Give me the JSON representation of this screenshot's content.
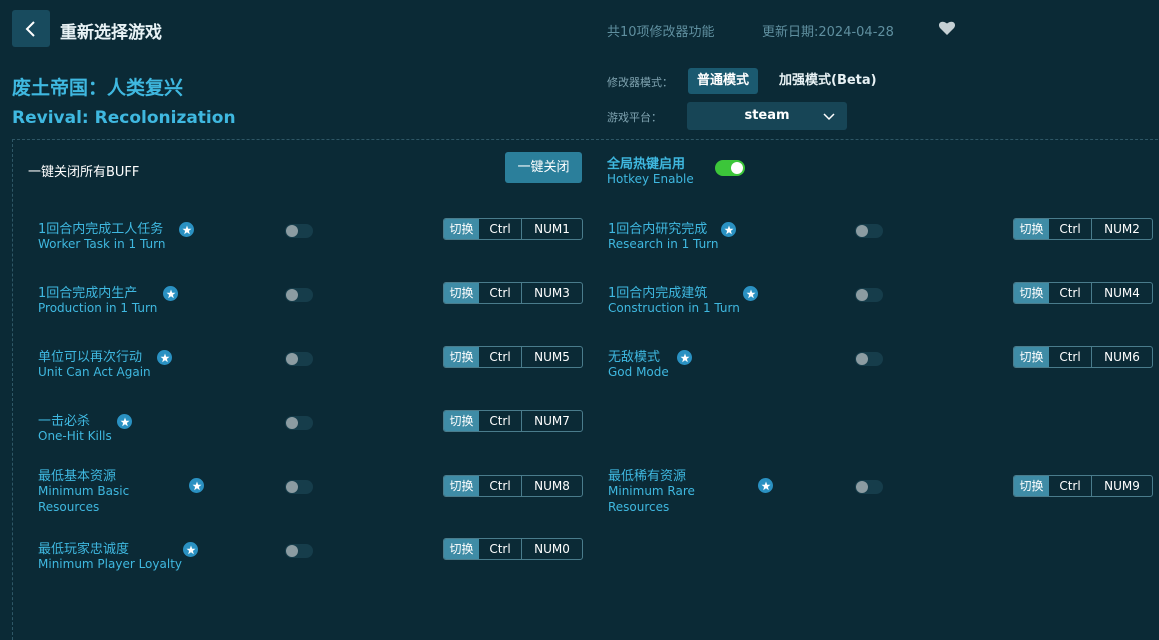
{
  "header": {
    "title": "重新选择游戏",
    "feature_count": "共10项修改器功能",
    "update_date": "更新日期:2024-04-28"
  },
  "game": {
    "name_cn": "废土帝国：人类复兴",
    "name_en": "Revival: Recolonization"
  },
  "mode": {
    "label": "修改器模式：",
    "normal": "普通模式",
    "beta": "加强模式(Beta)"
  },
  "platform": {
    "label": "游戏平台：",
    "value": "steam"
  },
  "controls": {
    "off_all_label": "一键关闭所有BUFF",
    "off_all_button": "一键关闭",
    "hotkey_cn": "全局热键启用",
    "hotkey_en": "Hotkey Enable"
  },
  "key_labels": {
    "switch": "切换",
    "ctrl": "Ctrl"
  },
  "cheats": [
    {
      "cn": "1回合内完成工人任务",
      "en": "Worker Task in 1 Turn",
      "key": "NUM1"
    },
    {
      "cn": "1回合内研究完成",
      "en": "Research in 1 Turn",
      "key": "NUM2"
    },
    {
      "cn": "1回合完成内生产",
      "en": "Production in 1 Turn",
      "key": "NUM3"
    },
    {
      "cn": "1回合内完成建筑",
      "en": "Construction in 1 Turn",
      "key": "NUM4"
    },
    {
      "cn": "单位可以再次行动",
      "en": "Unit Can Act Again",
      "key": "NUM5"
    },
    {
      "cn": "无敌模式",
      "en": "God Mode",
      "key": "NUM6"
    },
    {
      "cn": "一击必杀",
      "en": "One-Hit Kills",
      "key": "NUM7"
    },
    {
      "cn": "最低基本资源",
      "en": "Minimum Basic Resources",
      "key": "NUM8"
    },
    {
      "cn": "最低稀有资源",
      "en": "Minimum Rare Resources",
      "key": "NUM9"
    },
    {
      "cn": "最低玩家忠诚度",
      "en": "Minimum Player Loyalty",
      "key": "NUM0"
    }
  ],
  "colors": {
    "background": "#0b2a36",
    "accent": "#3fb8e0",
    "toggle_on": "#3cc63a"
  }
}
